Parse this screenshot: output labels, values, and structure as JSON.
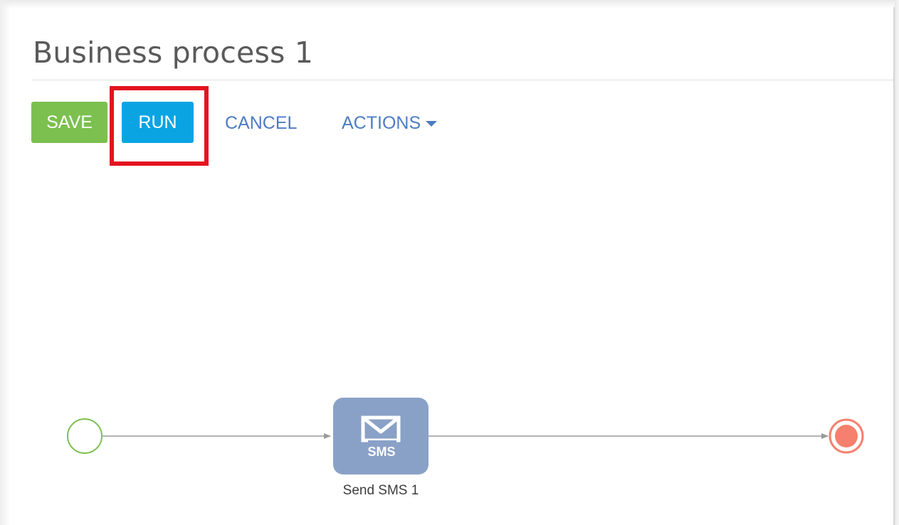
{
  "page": {
    "title": "Business process 1"
  },
  "toolbar": {
    "save_label": "SAVE",
    "run_label": "RUN",
    "cancel_label": "CANCEL",
    "actions_label": "ACTIONS"
  },
  "diagram": {
    "start_event": {
      "icon": "start-event-circle",
      "color": "#7cc04f"
    },
    "task": {
      "label": "Send SMS 1",
      "icon": "envelope-icon",
      "icon_text": "SMS",
      "color": "#8aa1c7"
    },
    "end_event": {
      "icon": "end-event-circle",
      "color": "#f5806e"
    }
  },
  "annotation": {
    "highlight": "run-button",
    "color": "#e3141f"
  },
  "colors": {
    "save_button": "#7cc04f",
    "run_button": "#0aa4e3",
    "link_text": "#4d7cc4"
  }
}
